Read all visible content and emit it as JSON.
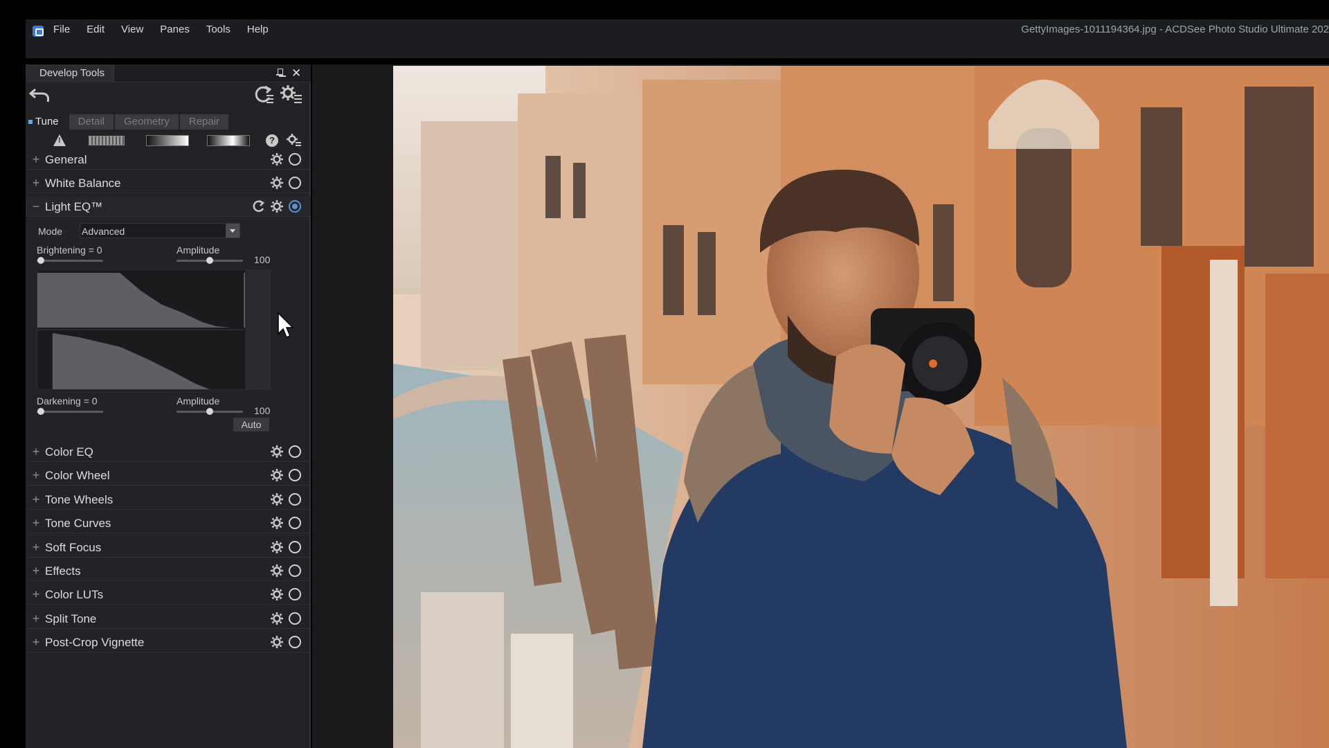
{
  "menubar": {
    "items": [
      "File",
      "Edit",
      "View",
      "Panes",
      "Tools",
      "Help"
    ],
    "window_title": "GettyImages-1011194364.jpg - ACDSee Photo Studio Ultimate 202"
  },
  "panel": {
    "title": "Develop Tools",
    "tabs": [
      "Tune",
      "Detail",
      "Geometry",
      "Repair"
    ],
    "active_tab": "Tune"
  },
  "sections_top": [
    {
      "label": "General",
      "expanded": false
    },
    {
      "label": "White Balance",
      "expanded": false
    }
  ],
  "light_eq": {
    "label": "Light EQ™",
    "expanded": true,
    "mode_label": "Mode",
    "mode_value": "Advanced",
    "brightening_label": "Brightening = 0",
    "amplitude_label_1": "Amplitude",
    "amplitude_value_1": "100",
    "darkening_label": "Darkening = 0",
    "amplitude_label_2": "Amplitude",
    "amplitude_value_2": "100",
    "auto_label": "Auto"
  },
  "sections_bottom": [
    {
      "label": "Color EQ"
    },
    {
      "label": "Color Wheel"
    },
    {
      "label": "Tone Wheels"
    },
    {
      "label": "Tone Curves"
    },
    {
      "label": "Soft Focus"
    },
    {
      "label": "Effects"
    },
    {
      "label": "Color LUTs"
    },
    {
      "label": "Split Tone"
    },
    {
      "label": "Post-Crop Vignette"
    }
  ],
  "colors": {
    "accent": "#5d8fd8",
    "panel_bg": "#222326",
    "menubar_bg": "#1c1d20"
  }
}
